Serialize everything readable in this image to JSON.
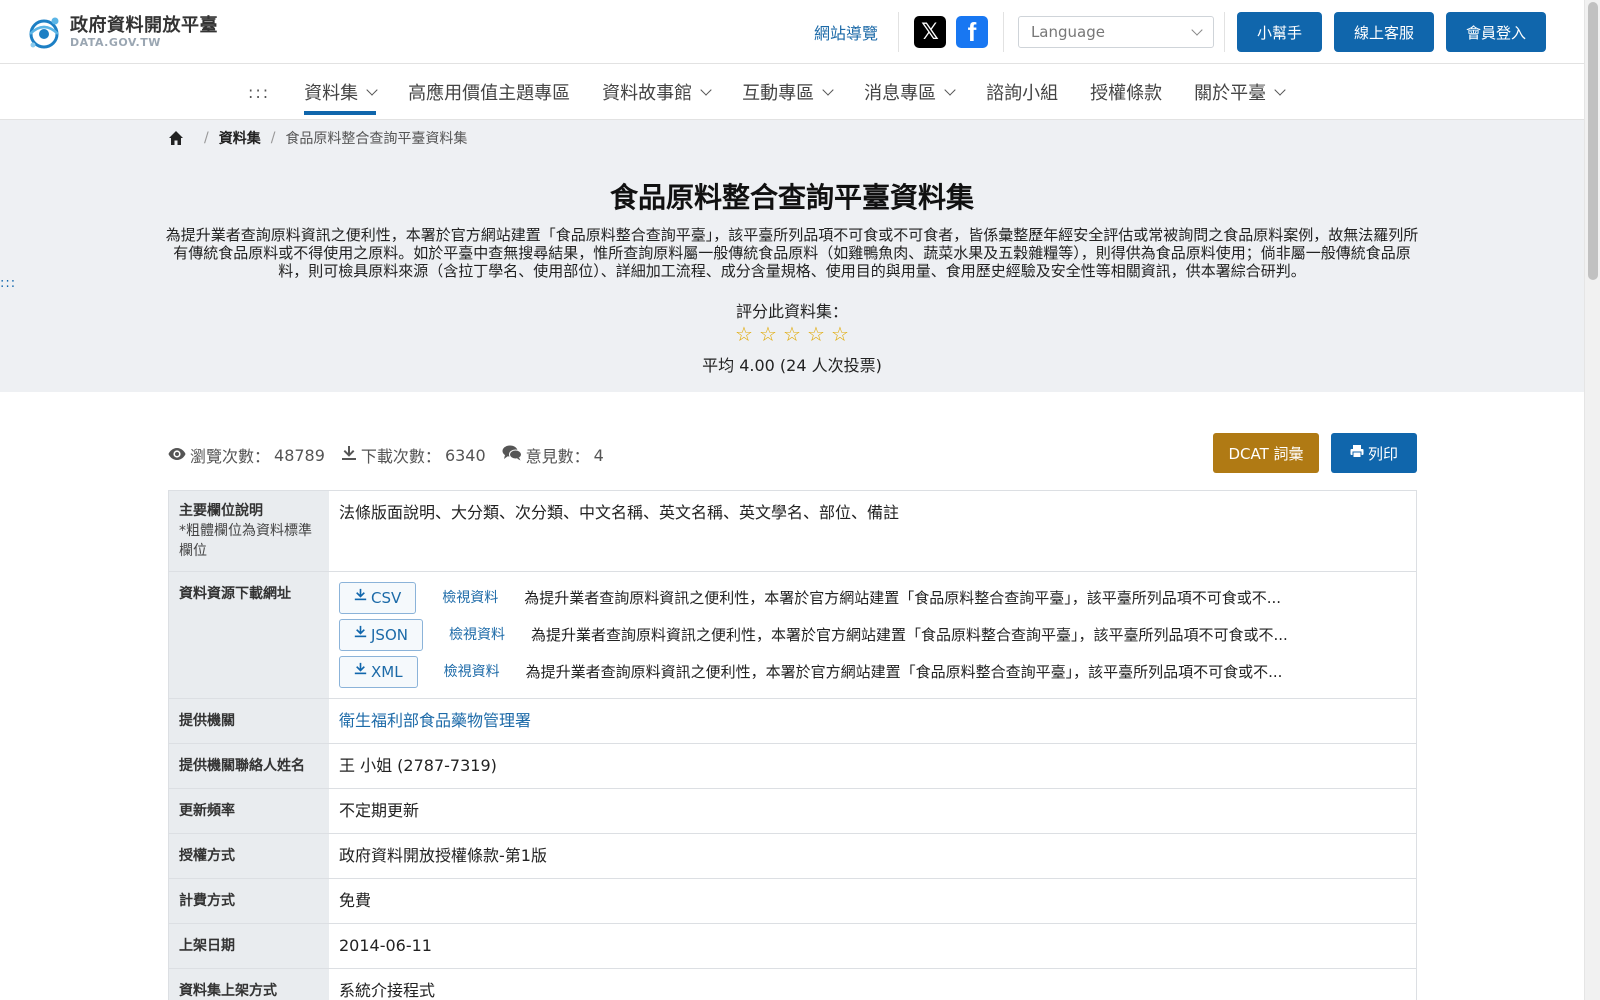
{
  "header": {
    "logo_title": "政府資料開放平臺",
    "logo_sub": "DATA.GOV.TW",
    "sitemap": "網站導覽",
    "social": [
      {
        "icon": "x-icon",
        "glyph": "𝕏"
      },
      {
        "icon": "facebook-icon",
        "glyph": "f"
      }
    ],
    "language_placeholder": "Language",
    "buttons": [
      "小幫手",
      "線上客服",
      "會員登入"
    ]
  },
  "nav": {
    "skip": ":::",
    "items": [
      "資料集",
      "高應用價值主題專區",
      "資料故事館",
      "互動專區",
      "消息專區",
      "諮詢小組",
      "授權條款",
      "關於平臺"
    ]
  },
  "breadcrumb": {
    "home_icon": "home-icon",
    "items": [
      "資料集",
      "食品原料整合查詢平臺資料集"
    ]
  },
  "side_skip": ":::",
  "dataset": {
    "title": "食品原料整合查詢平臺資料集",
    "description": "為提升業者查詢原料資訊之便利性，本署於官方網站建置「食品原料整合查詢平臺」，該平臺所列品項不可食或不可食者，皆係彙整歷年經安全評估或常被詢問之食品原料案例，故無法羅列所有傳統食品原料或不得使用之原料。如於平臺中查無搜尋結果，惟所查詢原料屬一般傳統食品原料（如雞鴨魚肉、蔬菜水果及五穀雜糧等），則得供為食品原料使用；倘非屬一般傳統食品原料，則可檢具原料來源（含拉丁學名、使用部位）、詳細加工流程、成分含量規格、使用目的與用量、食用歷史經驗及安全性等相關資訊，供本署綜合研判。",
    "rate_label": "評分此資料集：",
    "rating_stars": 5,
    "rate_avg": "平均 4.00 (24 人次投票)"
  },
  "stats": {
    "views_label": "瀏覽次數：",
    "views": "48789",
    "downloads_label": "下載次數：",
    "downloads": "6340",
    "comments_label": "意見數：",
    "comments": "4"
  },
  "actions": {
    "dcat": "DCAT 詞彙",
    "print": "列印"
  },
  "info": {
    "fields_head": "主要欄位說明",
    "fields_note": "*粗體欄位為資料標準欄位",
    "fields_value": "法條版面說明、大分類、次分類、中文名稱、英文名稱、英文學名、部位、備註",
    "resources_head": "資料資源下載網址",
    "resources": [
      {
        "format": "CSV",
        "view": "檢視資料",
        "desc": "為提升業者查詢原料資訊之便利性，本署於官方網站建置「食品原料整合查詢平臺」，該平臺所列品項不可食或不..."
      },
      {
        "format": "JSON",
        "view": "檢視資料",
        "desc": "為提升業者查詢原料資訊之便利性，本署於官方網站建置「食品原料整合查詢平臺」，該平臺所列品項不可食或不..."
      },
      {
        "format": "XML",
        "view": "檢視資料",
        "desc": "為提升業者查詢原料資訊之便利性，本署於官方網站建置「食品原料整合查詢平臺」，該平臺所列品項不可食或不..."
      }
    ],
    "rows": [
      {
        "label": "提供機關",
        "value": "衛生福利部食品藥物管理署",
        "link": true
      },
      {
        "label": "提供機關聯絡人姓名",
        "value": "王 小姐 (2787-7319)",
        "link": false
      },
      {
        "label": "更新頻率",
        "value": "不定期更新",
        "link": false
      },
      {
        "label": "授權方式",
        "value": "政府資料開放授權條款-第1版",
        "link": false
      },
      {
        "label": "計費方式",
        "value": "免費",
        "link": false
      },
      {
        "label": "上架日期",
        "value": "2014-06-11",
        "link": false
      },
      {
        "label": "資料集上架方式",
        "value": "系統介接程式",
        "link": false
      }
    ]
  },
  "colors": {
    "primary": "#1066ac",
    "dcat": "#b07a14",
    "star": "#e0a800",
    "hero_bg": "#eef0f3"
  }
}
